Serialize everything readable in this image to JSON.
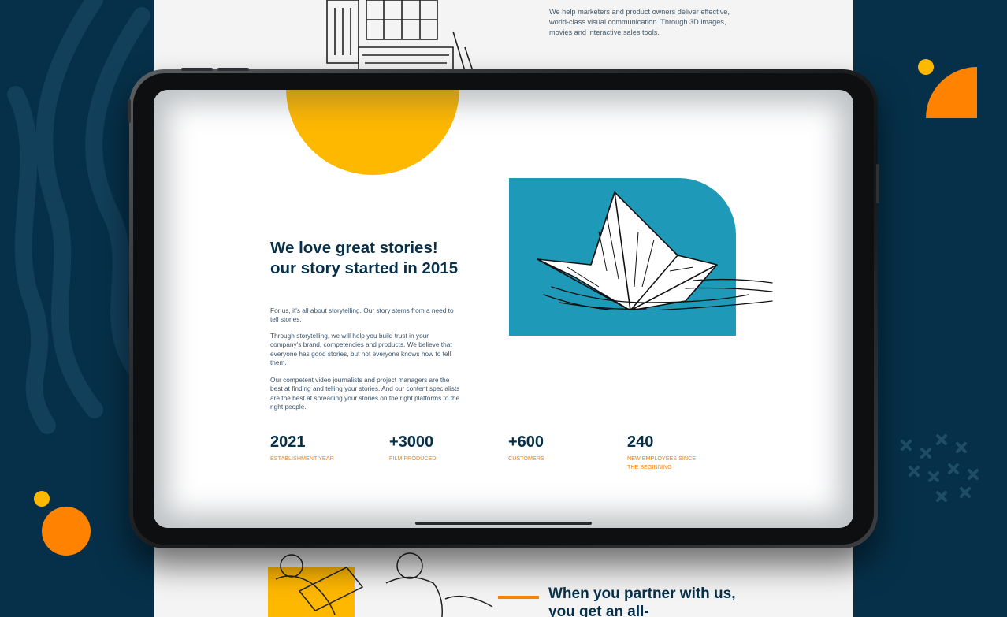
{
  "page_top": {
    "blurb": "We help marketers and product owners deliver effective, world-class visual communication. Through 3D images, movies and interactive sales tools."
  },
  "story": {
    "title": "We love great stories! our story started in 2015",
    "paragraphs": [
      "For us, it's all about storytelling. Our story stems from a need to tell stories.",
      "Through storytelling, we will help you build trust in your company's brand, competencies and products. We believe that everyone has good stories, but not everyone knows how to tell them.",
      "Our competent video journalists and project managers are the best at finding and telling your stories. And our content specialists are the best at spreading your stories on the right platforms to the right people."
    ]
  },
  "stats": [
    {
      "value": "2021",
      "label": "ESTABLISHMENT YEAR"
    },
    {
      "value": "+3000",
      "label": "FILM PRODUCED"
    },
    {
      "value": "+600",
      "label": "CUSTOMERS"
    },
    {
      "value": "240",
      "label": "NEW EMPLOYEES SINCE THE BEGINNING"
    }
  ],
  "page_bottom": {
    "heading": "When you partner with us, you get an all-"
  },
  "colors": {
    "navy": "#063049",
    "orange": "#ff8200",
    "yellow": "#ffb800",
    "teal": "#1e9ab8"
  },
  "icons": [
    "building-illustration",
    "paper-boat-illustration",
    "people-illustration"
  ]
}
